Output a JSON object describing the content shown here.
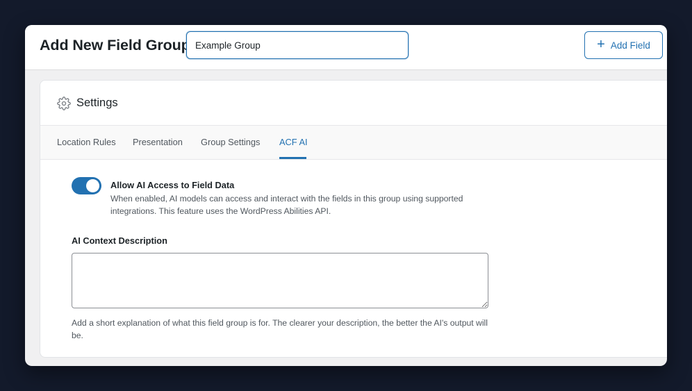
{
  "header": {
    "title": "Add New Field Group",
    "group_title_value": "Example Group",
    "add_field_label": "Add Field",
    "add_field_icon": "plus-icon"
  },
  "settings": {
    "title": "Settings",
    "icon": "gear-icon",
    "tabs": [
      {
        "label": "Location Rules",
        "active": false
      },
      {
        "label": "Presentation",
        "active": false
      },
      {
        "label": "Group Settings",
        "active": false
      },
      {
        "label": "ACF AI",
        "active": true
      }
    ],
    "ai_access": {
      "enabled": true,
      "label": "Allow AI Access to Field Data",
      "description": "When enabled, AI models can access and interact with the fields in this group using supported integrations. This feature uses the WordPress Abilities API."
    },
    "context": {
      "label": "AI Context Description",
      "value": "",
      "help": "Add a short explanation of what this field group is for. The clearer your description, the better the AI's output will be."
    }
  },
  "colors": {
    "accent": "#2271b1",
    "background": "#131a2b"
  }
}
